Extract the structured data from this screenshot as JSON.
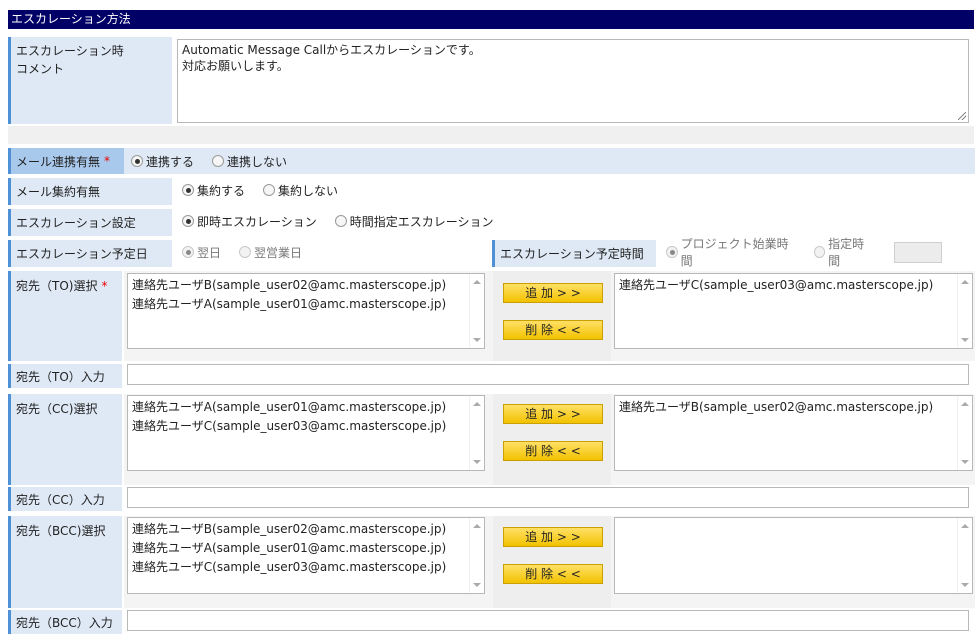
{
  "section": {
    "title": "エスカレーション方法"
  },
  "comment": {
    "label_line1": "エスカレーション時",
    "label_line2": "コメント",
    "value": "Automatic Message Callからエスカレーションです。\n対応お願いします。"
  },
  "mail_link": {
    "label": "メール連携有無",
    "required": "*",
    "options": [
      "連携する",
      "連携しない"
    ],
    "selected": 0
  },
  "mail_digest": {
    "label": "メール集約有無",
    "options": [
      "集約する",
      "集約しない"
    ],
    "selected": 0
  },
  "escalation_setting": {
    "label": "エスカレーション設定",
    "options": [
      "即時エスカレーション",
      "時間指定エスカレーション"
    ],
    "selected": 0
  },
  "schedule_day": {
    "label": "エスカレーション予定日",
    "options": [
      "翌日",
      "翌営業日"
    ],
    "selected": 0
  },
  "schedule_time": {
    "label": "エスカレーション予定時間",
    "options": [
      "プロジェクト始業時間",
      "指定時間"
    ],
    "selected": 0
  },
  "buttons": {
    "add": "追 加 > >",
    "remove": "削 除 < <"
  },
  "to": {
    "select_label": "宛先（TO)選択",
    "required": "*",
    "available": [
      "連絡先ユーザB(sample_user02@amc.masterscope.jp)",
      "連絡先ユーザA(sample_user01@amc.masterscope.jp)"
    ],
    "selected": [
      "連絡先ユーザC(sample_user03@amc.masterscope.jp)"
    ],
    "input_label": "宛先（TO）入力",
    "input_value": ""
  },
  "cc": {
    "select_label": "宛先（CC)選択",
    "available": [
      "連絡先ユーザA(sample_user01@amc.masterscope.jp)",
      "連絡先ユーザC(sample_user03@amc.masterscope.jp)"
    ],
    "selected": [
      "連絡先ユーザB(sample_user02@amc.masterscope.jp)"
    ],
    "input_label": "宛先（CC）入力",
    "input_value": ""
  },
  "bcc": {
    "select_label": "宛先（BCC)選択",
    "available": [
      "連絡先ユーザB(sample_user02@amc.masterscope.jp)",
      "連絡先ユーザA(sample_user01@amc.masterscope.jp)",
      "連絡先ユーザC(sample_user03@amc.masterscope.jp)"
    ],
    "selected": [],
    "input_label": "宛先（BCC）入力",
    "input_value": ""
  }
}
